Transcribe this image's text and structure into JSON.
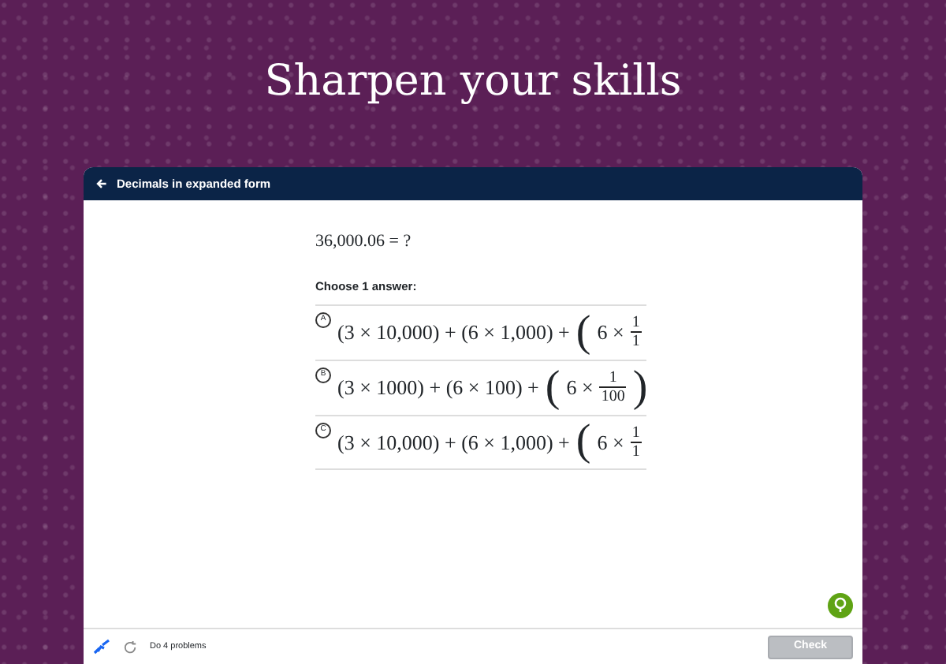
{
  "heading": "Sharpen your skills",
  "exercise": {
    "title": "Decimals in expanded form",
    "question": "36,000.06 = ?",
    "instruction": "Choose 1 answer:",
    "options": [
      {
        "letter": "A",
        "selected": false,
        "terms": "(3 × 10,000) + (6 × 1,000) +",
        "open": "(",
        "group_term": "6 ×",
        "numerator": "1",
        "denominator": "1"
      },
      {
        "letter": "B",
        "selected": false,
        "terms": "(3 × 1000) + (6 × 100) +",
        "open": "(",
        "group_term": "6 ×",
        "numerator": "1",
        "denominator": "100",
        "close": ")"
      },
      {
        "letter": "C",
        "selected": false,
        "terms": "(3 × 10,000) + (6 × 1,000) +",
        "open": "(",
        "group_term": "6 ×",
        "numerator": "1",
        "denominator": "1"
      }
    ],
    "footer": {
      "progress": "Do 4 problems",
      "check_button": {
        "label": "Check",
        "disabled": true
      }
    }
  }
}
